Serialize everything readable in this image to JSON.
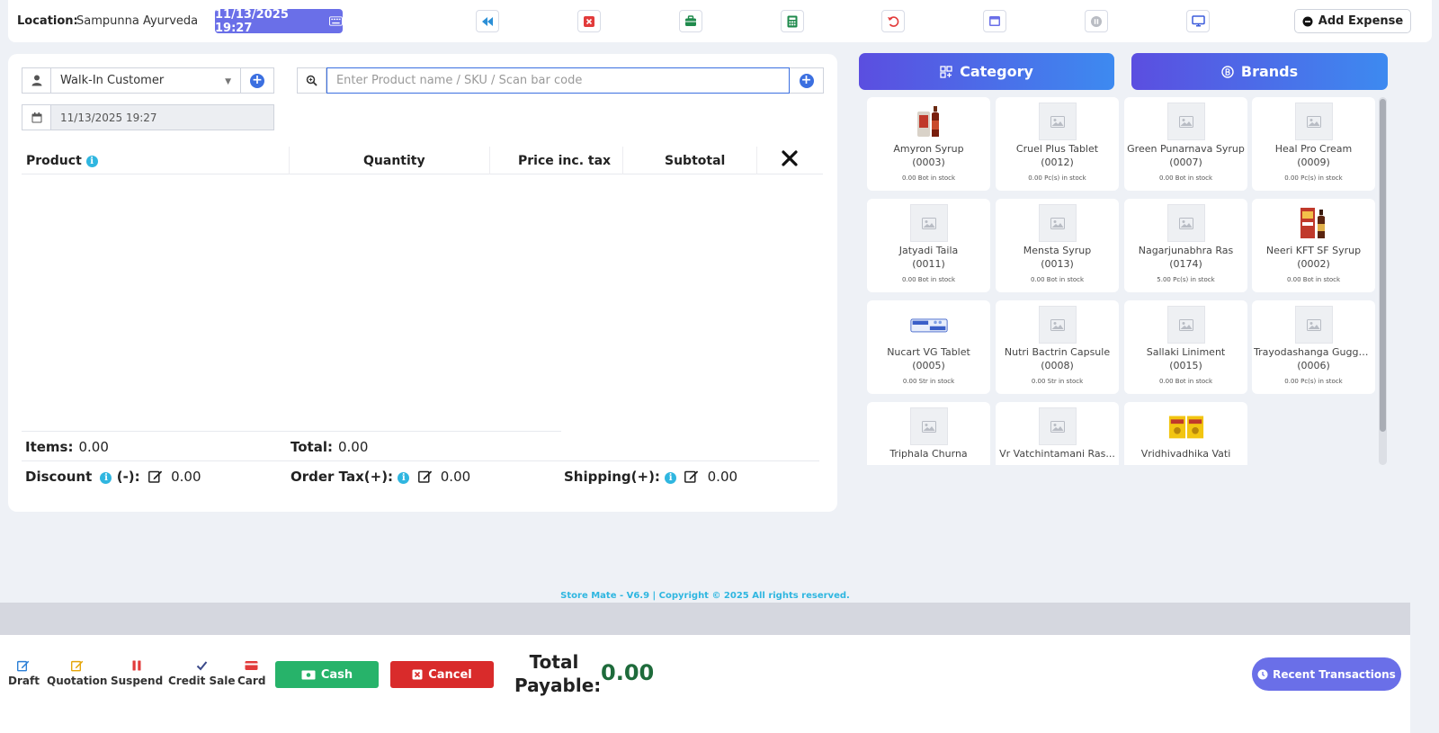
{
  "topbar": {
    "location_label": "Location:",
    "location_value": "Sampunna Ayurveda",
    "datetime": "11/13/2025 19:27",
    "add_expense_label": "Add Expense"
  },
  "customer": {
    "selected": "Walk-In Customer"
  },
  "search": {
    "placeholder": "Enter Product name / SKU / Scan bar code"
  },
  "transaction_date": "11/13/2025 19:27",
  "table": {
    "headers": {
      "product": "Product",
      "quantity": "Quantity",
      "price": "Price inc. tax",
      "subtotal": "Subtotal"
    }
  },
  "totals": {
    "items_label": "Items:",
    "items_value": "0.00",
    "total_label": "Total:",
    "total_value": "0.00",
    "discount_label": "Discount",
    "discount_sign": "(-):",
    "discount_value": "0.00",
    "order_tax_label": "Order Tax(+):",
    "order_tax_value": "0.00",
    "shipping_label": "Shipping(+):",
    "shipping_value": "0.00"
  },
  "tabs": {
    "category": "Category",
    "brands": "Brands"
  },
  "products": [
    {
      "name": "Amyron Syrup",
      "sku": "(0003)",
      "stock": "0.00 Bot in stock",
      "image": "bottle-red"
    },
    {
      "name": "Cruel Plus Tablet",
      "sku": "(0012)",
      "stock": "0.00 Pc(s) in stock",
      "image": "placeholder"
    },
    {
      "name": "Green Punarnava Syrup",
      "sku": "(0007)",
      "stock": "0.00 Bot in stock",
      "image": "placeholder"
    },
    {
      "name": "Heal Pro Cream",
      "sku": "(0009)",
      "stock": "0.00 Pc(s) in stock",
      "image": "placeholder"
    },
    {
      "name": "Jatyadi Taila",
      "sku": "(0011)",
      "stock": "0.00 Bot in stock",
      "image": "placeholder"
    },
    {
      "name": "Mensta Syrup",
      "sku": "(0013)",
      "stock": "0.00 Bot in stock",
      "image": "placeholder"
    },
    {
      "name": "Nagarjunabhra Ras",
      "sku": "(0174)",
      "stock": "5.00 Pc(s) in stock",
      "image": "placeholder"
    },
    {
      "name": "Neeri KFT SF Syrup",
      "sku": "(0002)",
      "stock": "0.00 Bot in stock",
      "image": "box-bottle"
    },
    {
      "name": "Nucart VG Tablet",
      "sku": "(0005)",
      "stock": "0.00 Str in stock",
      "image": "strip-blue"
    },
    {
      "name": "Nutri Bactrin Capsule",
      "sku": "(0008)",
      "stock": "0.00 Str in stock",
      "image": "placeholder"
    },
    {
      "name": "Sallaki Liniment",
      "sku": "(0015)",
      "stock": "0.00 Bot in stock",
      "image": "placeholder"
    },
    {
      "name": "Trayodashanga Guggul...",
      "sku": "(0006)",
      "stock": "0.00 Pc(s) in stock",
      "image": "placeholder"
    },
    {
      "name": "Triphala Churna",
      "sku": "",
      "stock": "",
      "image": "placeholder"
    },
    {
      "name": "Vr Vatchintamani Ras...",
      "sku": "",
      "stock": "",
      "image": "placeholder"
    },
    {
      "name": "Vridhivadhika Vati",
      "sku": "",
      "stock": "",
      "image": "box-yellow"
    }
  ],
  "footer": {
    "text": "Store Mate - V6.9 | Copyright © 2025 All rights reserved."
  },
  "bottom": {
    "draft": "Draft",
    "quotation": "Quotation",
    "suspend": "Suspend",
    "credit_sale": "Credit Sale",
    "card": "Card",
    "cash": "Cash",
    "cancel": "Cancel",
    "total_payable_label": "Total Payable:",
    "total_payable_value": "0.00",
    "recent_transactions": "Recent Transactions"
  },
  "colors": {
    "accent": "#6a6fe8",
    "primary_blue": "#3b6fe0",
    "cash_green": "#27b36a",
    "cancel_red": "#d92b2b",
    "info_cyan": "#2fb6e0",
    "total_green": "#1e6b3b"
  }
}
